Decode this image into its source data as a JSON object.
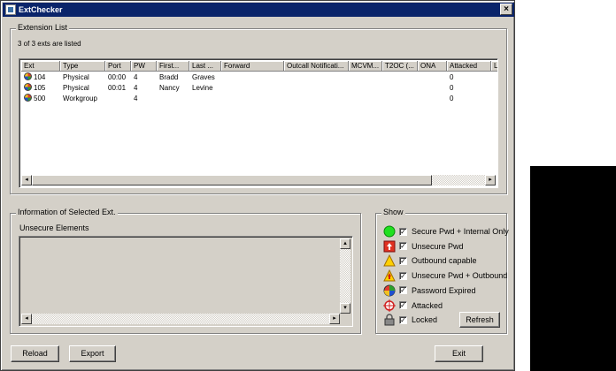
{
  "window": {
    "title": "ExtChecker",
    "close_glyph": "×"
  },
  "extension_list": {
    "title": "Extension List",
    "count_text": "3 of 3 exts are listed",
    "columns": [
      {
        "label": "Ext",
        "w": 44
      },
      {
        "label": "Type",
        "w": 51
      },
      {
        "label": "Port",
        "w": 29
      },
      {
        "label": "PW",
        "w": 29
      },
      {
        "label": "First...",
        "w": 37
      },
      {
        "label": "Last ...",
        "w": 36
      },
      {
        "label": "Forward",
        "w": 71
      },
      {
        "label": "Outcall Notificati...",
        "w": 73
      },
      {
        "label": "MCVM...",
        "w": 38
      },
      {
        "label": "T2OC (...",
        "w": 40
      },
      {
        "label": "ONA",
        "w": 33
      },
      {
        "label": "Attacked",
        "w": 50
      },
      {
        "label": "L",
        "w": 8
      }
    ],
    "rows": [
      [
        "104",
        "Physical",
        "00:00",
        "4",
        "Bradd",
        "Graves",
        "",
        "",
        "",
        "",
        "",
        "0",
        ""
      ],
      [
        "105",
        "Physical",
        "00:01",
        "4",
        "Nancy",
        "Levine",
        "",
        "",
        "",
        "",
        "",
        "0",
        ""
      ],
      [
        "500",
        "Workgroup",
        "",
        "4",
        "",
        "",
        "",
        "",
        "",
        "",
        "",
        "0",
        ""
      ]
    ],
    "row_icon": "expired-password-icon"
  },
  "info": {
    "title": "Information of Selected Ext.",
    "unsecure_label": "Unsecure Elements"
  },
  "show": {
    "title": "Show",
    "items": [
      {
        "label": "Secure Pwd + Internal Only",
        "icon": "green-circle-icon",
        "checked": true
      },
      {
        "label": "Unsecure Pwd",
        "icon": "red-arrow-icon",
        "checked": true
      },
      {
        "label": "Outbound capable",
        "icon": "yellow-triangle-icon",
        "checked": true
      },
      {
        "label": "Unsecure Pwd + Outbound",
        "icon": "warning-triangle-arrow-icon",
        "checked": true
      },
      {
        "label": "Password Expired",
        "icon": "expired-password-icon",
        "checked": true
      },
      {
        "label": "Attacked",
        "icon": "crosshair-icon",
        "checked": true
      },
      {
        "label": "Locked",
        "icon": "padlock-icon",
        "checked": true
      }
    ],
    "refresh_label": "Refresh"
  },
  "footer": {
    "reload_label": "Reload",
    "export_label": "Export",
    "exit_label": "Exit"
  }
}
